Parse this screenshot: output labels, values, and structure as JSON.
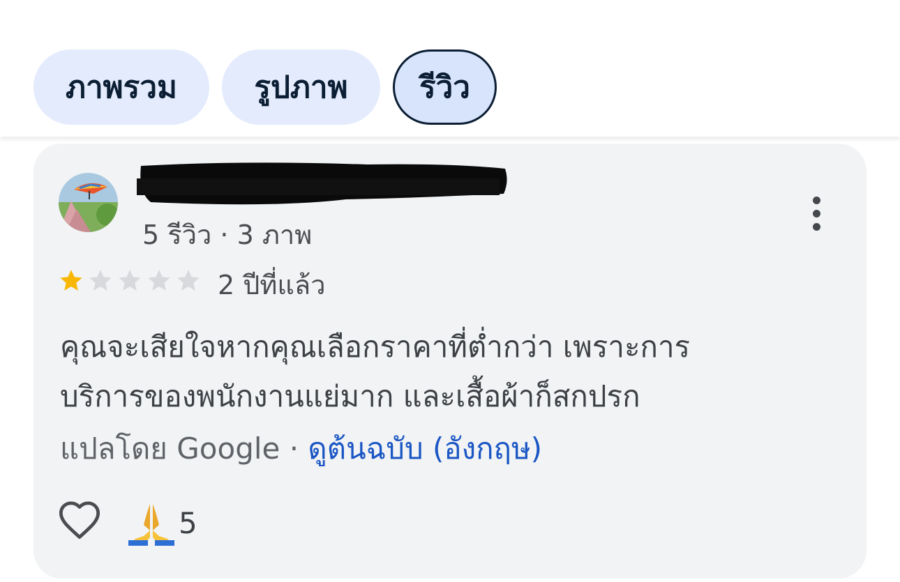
{
  "tabs": [
    {
      "label": "ภาพรวม",
      "selected": false
    },
    {
      "label": "รูปภาพ",
      "selected": false
    },
    {
      "label": "รีวิว",
      "selected": true
    }
  ],
  "review": {
    "reviewer_meta": "5 รีวิว · 3 ภาพ",
    "rating": 1,
    "rating_max": 5,
    "time_ago": "2 ปีที่แล้ว",
    "text_lines": [
      "คุณจะเสียใจหากคุณเลือกราคาที่ต่ำกว่า เพราะการ",
      "บริการของพนักงานแย่มาก และเสื้อผ้าก็สกปรก"
    ],
    "translated_by": "แปลโดย Google · ",
    "see_original": "ดูต้นฉบับ (อังกฤษ)",
    "reaction_count": "5"
  },
  "icons": {
    "like": "heart-outline-icon",
    "reaction": "folded-hands-emoji",
    "more": "more-vert-icon"
  },
  "colors": {
    "accent_link": "#1a56c4",
    "chip_bg": "#e3ebfd",
    "star_filled": "#f9b705",
    "star_empty": "#d7d9dc"
  }
}
